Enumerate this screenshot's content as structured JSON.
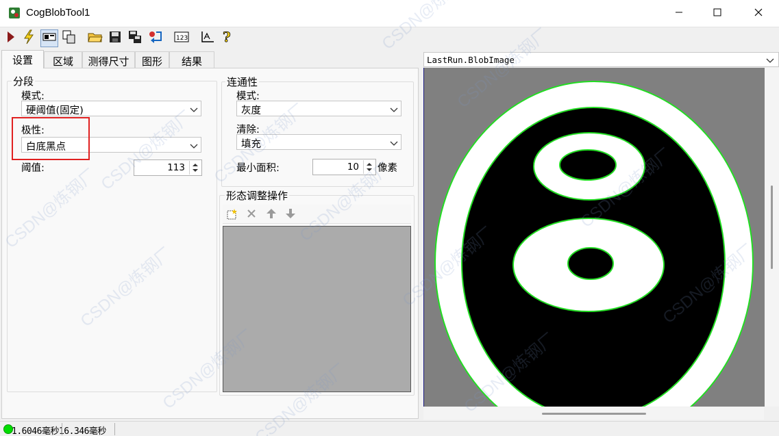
{
  "window": {
    "title": "CogBlobTool1",
    "minimize_icon": "minimize-icon",
    "maximize_icon": "maximize-icon",
    "close_icon": "close-icon"
  },
  "toolbar": {
    "icons": [
      "run-icon",
      "lightning-icon",
      "image-view-icon",
      "copy-icon",
      "open-folder-icon",
      "save-icon",
      "save-as-icon",
      "reset-icon",
      "numeric-icon",
      "measure-icon",
      "help-icon"
    ]
  },
  "tabs": [
    "设置",
    "区域",
    "测得尺寸",
    "图形",
    "结果"
  ],
  "segmentation": {
    "group_label": "分段",
    "mode_label": "模式:",
    "mode_value": "硬阈值(固定)",
    "polarity_label": "极性:",
    "polarity_value": "白底黑点",
    "threshold_label": "阈值:",
    "threshold_value": "113"
  },
  "connectivity": {
    "group_label": "连通性",
    "mode_label": "模式:",
    "mode_value": "灰度",
    "clear_label": "清除:",
    "clear_value": "填充",
    "min_area_label": "最小面积:",
    "min_area_value": "10",
    "min_area_unit": "像素"
  },
  "morphology": {
    "group_label": "形态调整操作",
    "icons": [
      "add-icon",
      "delete-icon",
      "move-up-icon",
      "move-down-icon"
    ]
  },
  "display": {
    "selected_image": "LastRun.BlobImage"
  },
  "status": {
    "text": "1.6046毫秒16.346毫秒"
  },
  "watermark": "CSDN@炼钢厂",
  "colors": {
    "highlight": "#e02020",
    "blob_outline": "#22dd22",
    "status_ok": "#00dd00"
  }
}
